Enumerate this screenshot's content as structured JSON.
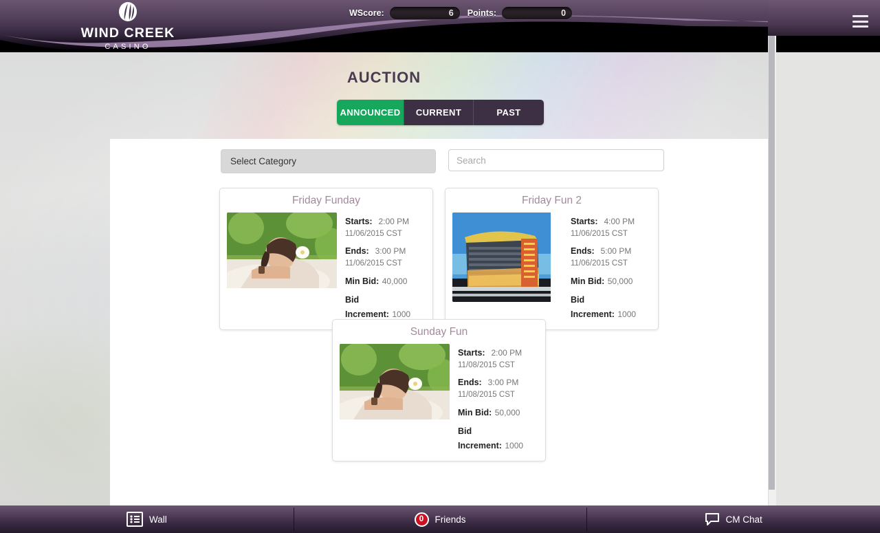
{
  "header": {
    "logo_primary": "WIND CREEK",
    "logo_secondary": "CASINO",
    "logo_mark_icon": "wind-creek-feather-logo",
    "wscore_label": "WScore:",
    "wscore_value": "6",
    "points_label": "Points:",
    "points_value": "0",
    "menu_icon": "hamburger-menu-icon"
  },
  "page": {
    "title": "AUCTION",
    "tabs": [
      {
        "label": "ANNOUNCED",
        "active": true
      },
      {
        "label": "CURRENT",
        "active": false
      },
      {
        "label": "PAST",
        "active": false
      }
    ]
  },
  "filters": {
    "category_label": "Select Category",
    "search_value": "",
    "search_placeholder": "Search"
  },
  "labels": {
    "starts": "Starts:",
    "ends": "Ends:",
    "min_bid": "Min Bid:",
    "bid_increment": "Bid Increment:"
  },
  "auctions": [
    {
      "title": "Friday Funday",
      "image": "spa-massage-woman-photo",
      "starts_time": "2:00 PM",
      "starts_date": "11/06/2015 CST",
      "ends_time": "3:00 PM",
      "ends_date": "11/06/2015 CST",
      "min_bid": "40,000",
      "bid_increment": "1000"
    },
    {
      "title": "Friday Fun 2",
      "image": "casino-hotel-tower-photo",
      "starts_time": "4:00 PM",
      "starts_date": "11/06/2015 CST",
      "ends_time": "5:00 PM",
      "ends_date": "11/06/2015 CST",
      "min_bid": "50,000",
      "bid_increment": "1000"
    },
    {
      "title": "Sunday Fun",
      "image": "spa-massage-woman-photo",
      "starts_time": "2:00 PM",
      "starts_date": "11/08/2015 CST",
      "ends_time": "3:00 PM",
      "ends_date": "11/08/2015 CST",
      "min_bid": "50,000",
      "bid_increment": "1000"
    }
  ],
  "bottom_bar": [
    {
      "label": "Wall",
      "icon": "list-icon",
      "badge": null
    },
    {
      "label": "Friends",
      "icon": "friends-badge-icon",
      "badge": "0"
    },
    {
      "label": "CM Chat",
      "icon": "chat-bubble-icon",
      "badge": null
    }
  ],
  "colors": {
    "accent_green": "#16a75c",
    "tab_dark": "#3d3044",
    "brand_purple": "#5b4762",
    "badge_red": "#cc1122",
    "card_title": "#a4899d"
  }
}
